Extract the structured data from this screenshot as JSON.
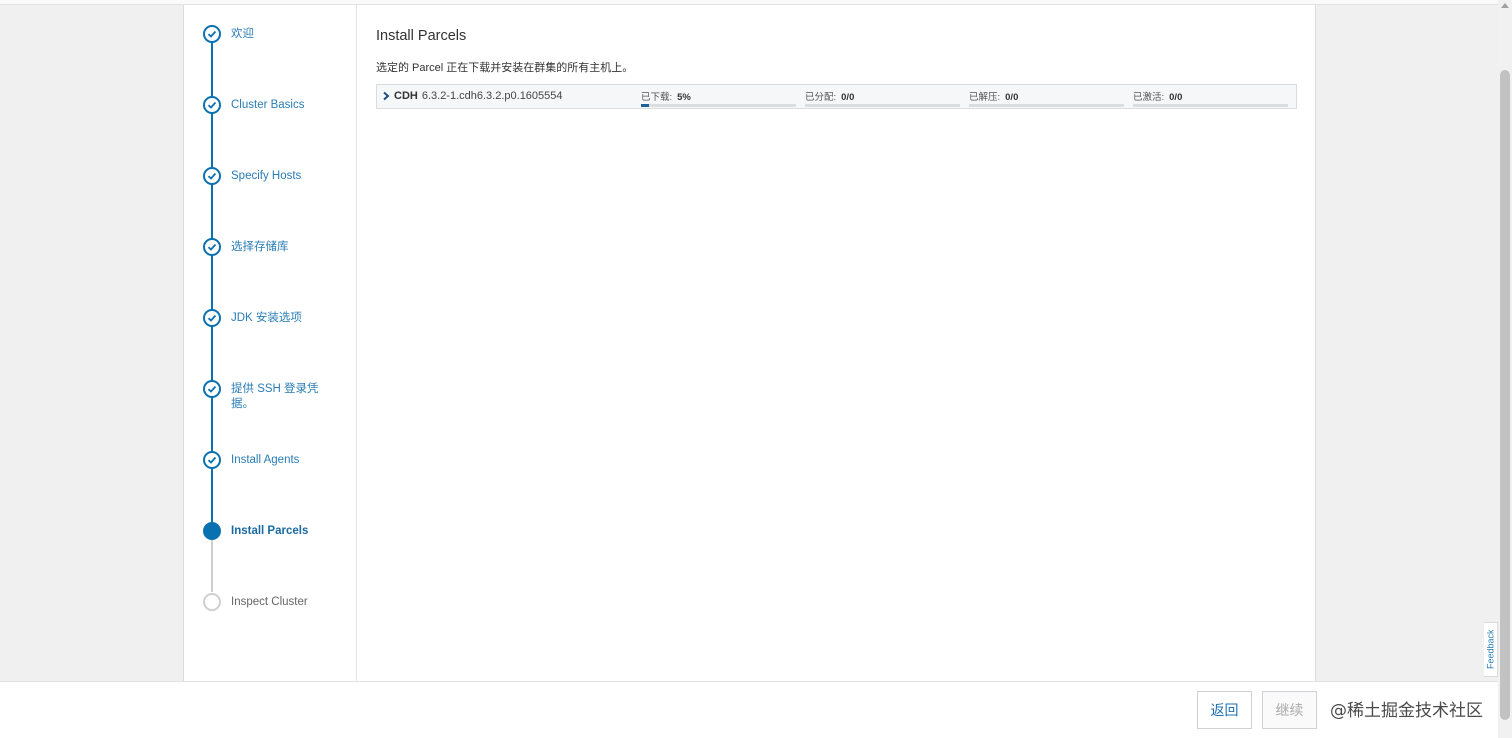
{
  "steps": [
    {
      "label": "欢迎",
      "state": "done"
    },
    {
      "label": "Cluster Basics",
      "state": "done"
    },
    {
      "label": "Specify Hosts",
      "state": "done"
    },
    {
      "label": "选择存储库",
      "state": "done"
    },
    {
      "label": "JDK 安装选项",
      "state": "done"
    },
    {
      "label": "提供 SSH 登录凭据。",
      "state": "done"
    },
    {
      "label": "Install Agents",
      "state": "done"
    },
    {
      "label": "Install Parcels",
      "state": "current"
    },
    {
      "label": "Inspect Cluster",
      "state": "todo"
    }
  ],
  "main": {
    "title": "Install Parcels",
    "description": "选定的 Parcel 正在下载并安装在群集的所有主机上。"
  },
  "parcel": {
    "name": "CDH",
    "version": "6.3.2-1.cdh6.3.2.p0.1605554",
    "stats": [
      {
        "label": "已下载:",
        "value": "5%",
        "progress": 0.05
      },
      {
        "label": "已分配:",
        "value": "0/0",
        "progress": 0
      },
      {
        "label": "已解压:",
        "value": "0/0",
        "progress": 0
      },
      {
        "label": "已激活:",
        "value": "0/0",
        "progress": 0
      }
    ]
  },
  "footer": {
    "back_label": "返回",
    "next_label": "继续",
    "watermark": "@稀土掘金技术社区"
  },
  "feedback_label": "Feedback",
  "colors": {
    "accent": "#0a71b0",
    "progress": "#1a5f96"
  }
}
